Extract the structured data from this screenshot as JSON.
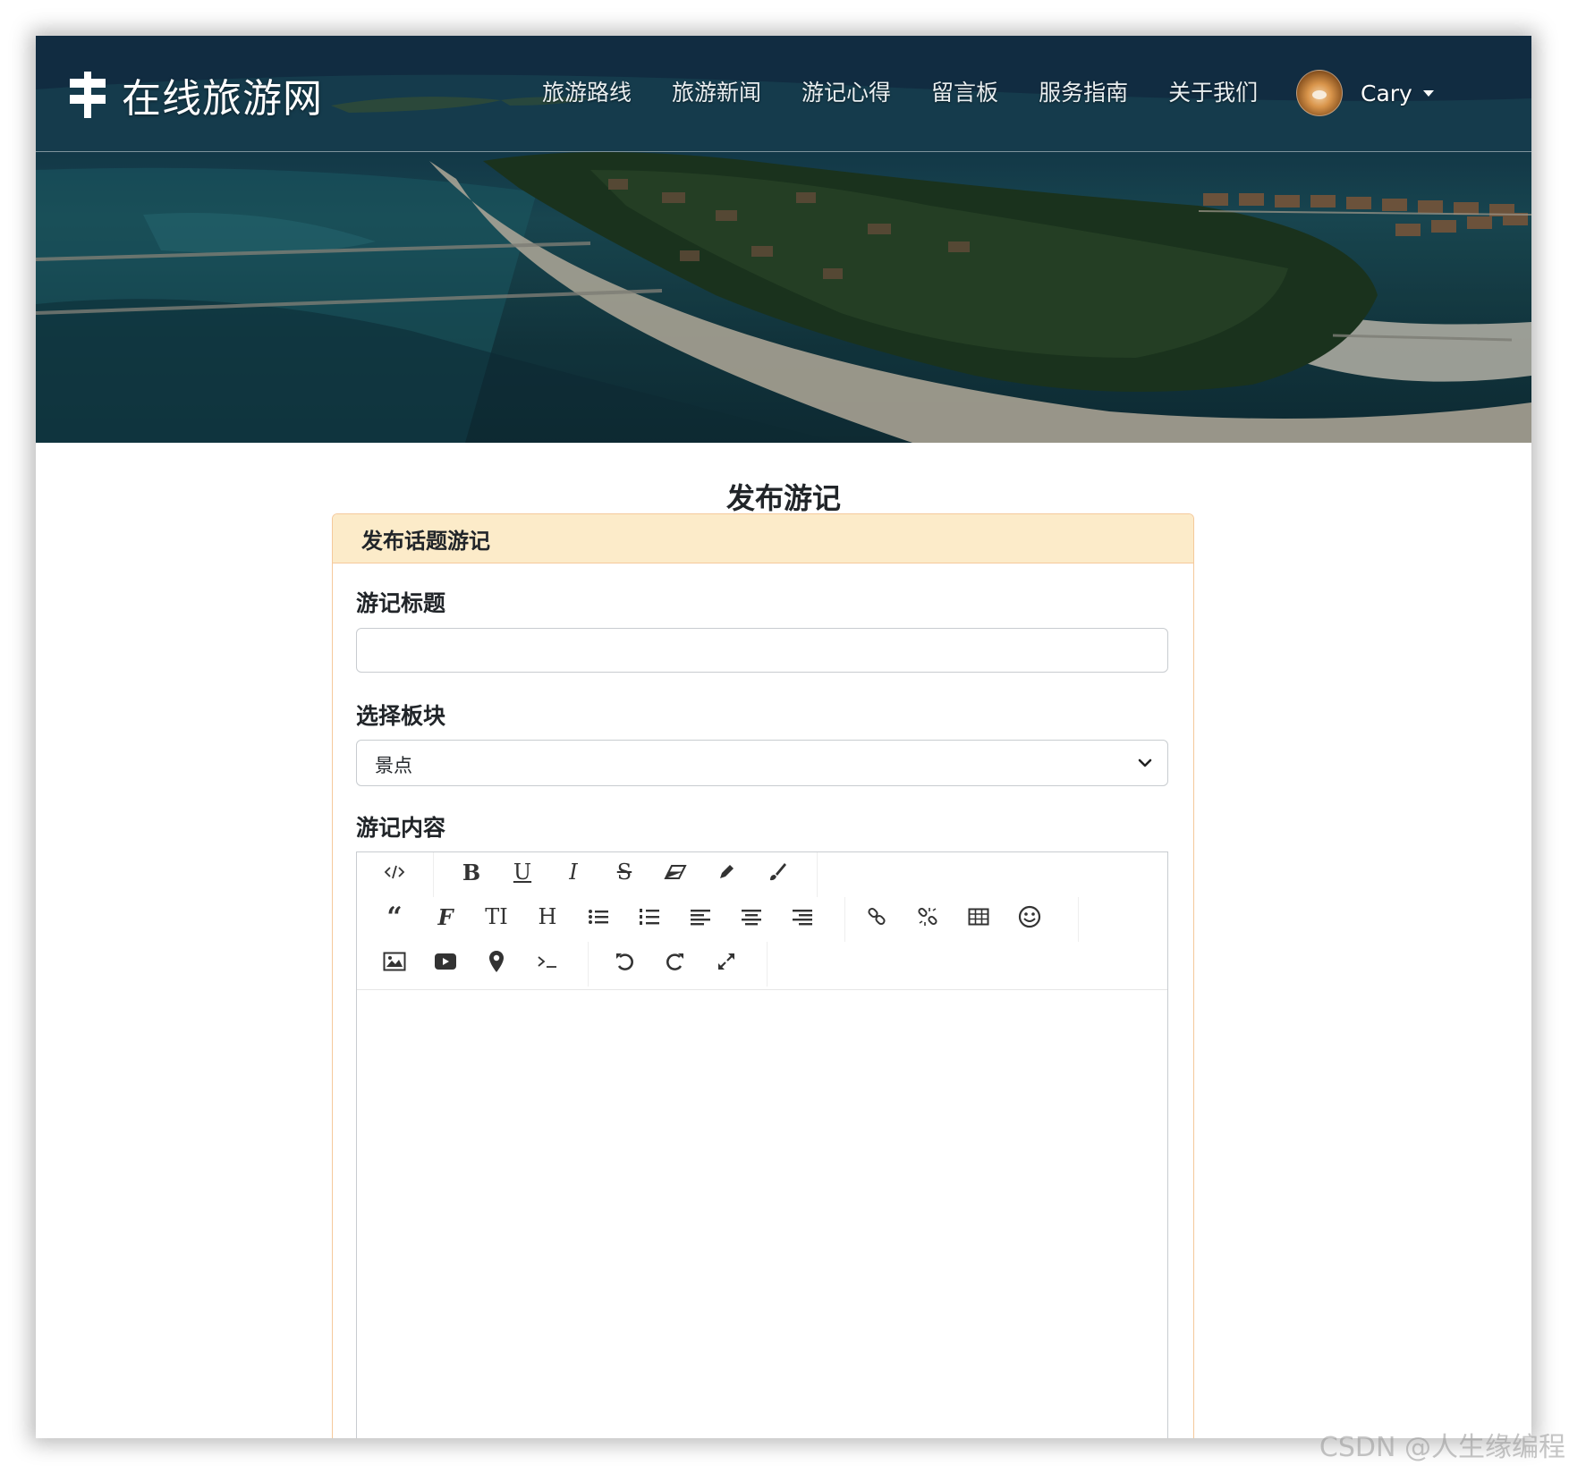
{
  "navbar": {
    "brand": "在线旅游网",
    "links": [
      "旅游路线",
      "旅游新闻",
      "游记心得",
      "留言板",
      "服务指南",
      "关于我们"
    ],
    "user_name": "Cary"
  },
  "main": {
    "page_title": "发布游记",
    "card_header": "发布话题游记",
    "title_label": "游记标题",
    "title_value": "",
    "board_label": "选择板块",
    "board_selected": "景点",
    "content_label": "游记内容"
  },
  "editor": {
    "toolbar_icons": [
      "code-view-icon",
      "bold-icon",
      "underline-icon",
      "italic-icon",
      "strikethrough-icon",
      "eraser-icon",
      "pencil-icon",
      "brush-icon",
      "blockquote-icon",
      "font-family-icon",
      "font-size-icon",
      "heading-icon",
      "bullet-list-icon",
      "numbered-list-icon",
      "align-left-icon",
      "align-center-icon",
      "align-right-icon",
      "link-icon",
      "unlink-icon",
      "table-icon",
      "emoji-icon",
      "image-icon",
      "video-icon",
      "location-icon",
      "code-icon",
      "undo-icon",
      "redo-icon",
      "fullscreen-icon"
    ]
  },
  "watermark": "CSDN @人生缘编程",
  "colors": {
    "card_border": "#f5c99b",
    "card_header_bg": "#fcebc9",
    "text": "#212529"
  }
}
